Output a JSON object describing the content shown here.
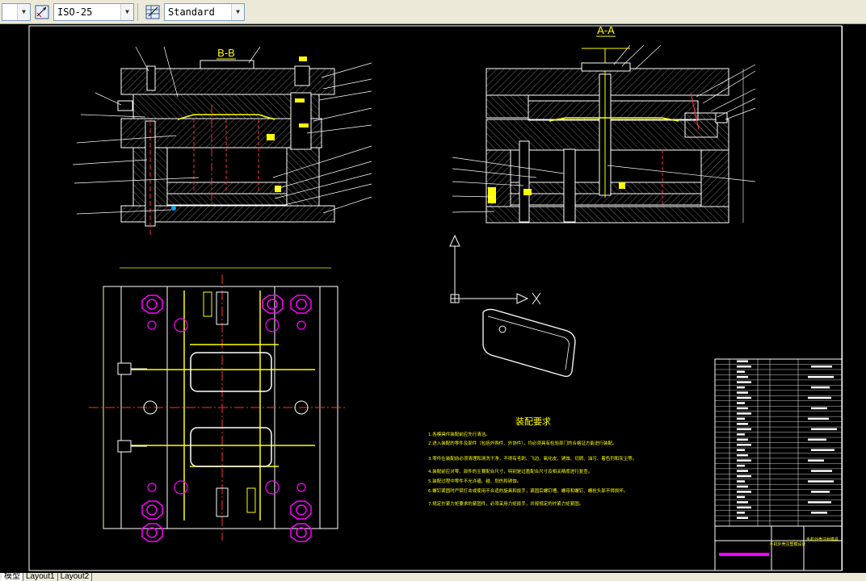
{
  "toolbar": {
    "dim_style": "ISO-25",
    "table_style": "Standard",
    "dim_icon": "dimension-style-icon",
    "table_icon": "table-style-icon"
  },
  "drawing": {
    "title_bb": "B-B",
    "title_aa": "A-A",
    "notes_title": "装配要求",
    "notes": [
      "1.各模具件装配前应先行清洁。",
      "2.进入装配的零件及部件（包括外购件、外协件），均必须具有检验部门的合格证方能进行装配。",
      "3.零件在装配前必须清理和清洗干净，不得有毛刺、飞边、氧化皮、锈蚀、切屑、油污、着色剂和灰尘等。",
      "4.装配前应对零、部件的主要配合尺寸，特别是过盈配合尺寸及相关精度进行复查。",
      "5.装配过程中零件不允许磕、碰、划伤和锈蚀。",
      "6.螺钉紧固时严禁打击或使用不合适的旋具和扳手，紧固后螺钉槽、螺母和螺钉、螺栓头部不得损坏。",
      "7.规定拧紧力矩要求的紧固件，必须采用力矩扳手，并按规定的拧紧力矩紧固。"
    ],
    "title_block_name": "手机外壳注塑模设计",
    "title_block_drawing": "手机外壳注射模具"
  },
  "tabs": [
    "模型",
    "Layout1",
    "Layout2"
  ],
  "colors": {
    "bg": "#000000",
    "line": "#ffffff",
    "hatch": "#8a8a8a",
    "magenta": "#ff00ff",
    "yellow": "#ffff00",
    "red": "#ff3030",
    "green": "#00ff00"
  }
}
